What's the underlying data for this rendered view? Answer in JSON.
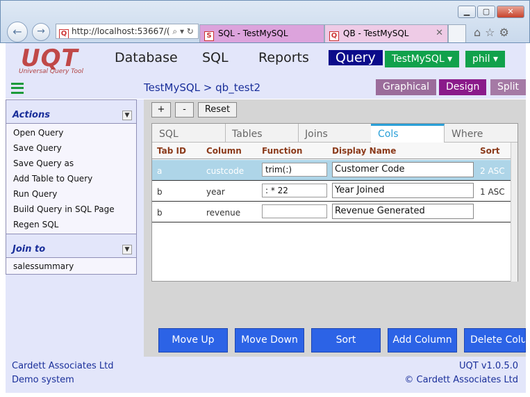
{
  "browser": {
    "address": "http://localhost:53667/(",
    "tabs": [
      {
        "label": "SQL - TestMySQL",
        "favicon": "S"
      },
      {
        "label": "QB - TestMySQL",
        "favicon": "Q"
      }
    ],
    "address_favicon": "Q"
  },
  "app": {
    "logo": "UQT",
    "logo_sub": "Universal Query Tool",
    "menu": [
      "Database",
      "SQL",
      "Reports",
      "Query"
    ],
    "db_button": "TestMySQL",
    "user_button": "phil",
    "breadcrumb": "TestMySQL > qb_test2",
    "views": [
      "Graphical",
      "Design",
      "Split"
    ]
  },
  "sidebar": {
    "actions_title": "Actions",
    "actions": [
      "Open Query",
      "Save Query",
      "Save Query as",
      "Add Table to Query",
      "Run Query",
      "Build Query in SQL Page",
      "Regen SQL"
    ],
    "join_title": "Join to",
    "joins": [
      "salessummary"
    ]
  },
  "toolbar": {
    "plus": "+",
    "minus": "-",
    "reset": "Reset"
  },
  "work_tabs": [
    "SQL",
    "Tables",
    "Joins",
    "Cols",
    "Where"
  ],
  "table": {
    "headers": [
      "Tab ID",
      "Column",
      "Function",
      "Display Name",
      "Sort"
    ],
    "rows": [
      {
        "tab": "a",
        "column": "custcode",
        "function": "trim(:)",
        "display": "Customer Code",
        "sort": "2 ASC"
      },
      {
        "tab": "b",
        "column": "year",
        "function": ": * 22",
        "display": "Year Joined",
        "sort": "1 ASC"
      },
      {
        "tab": "b",
        "column": "revenue",
        "function": "",
        "display": "Revenue Generated",
        "sort": ""
      }
    ]
  },
  "buttons": [
    "Move Up",
    "Move Down",
    "Sort",
    "Add Column",
    "Delete Column"
  ],
  "footer": {
    "company": "Cardett Associates Ltd",
    "system": "Demo system",
    "version": "UQT v1.0.5.0",
    "copyright": "© Cardett Associates Ltd"
  },
  "colors": {
    "menu_active": "#0b0b8a",
    "green": "#11a14b",
    "view_graphical": "#9b6c9b",
    "view_design": "#8a1a8a",
    "view_split": "#a57aa5",
    "button_blue": "#2c63e6",
    "selected_row": "#aed5e8"
  }
}
